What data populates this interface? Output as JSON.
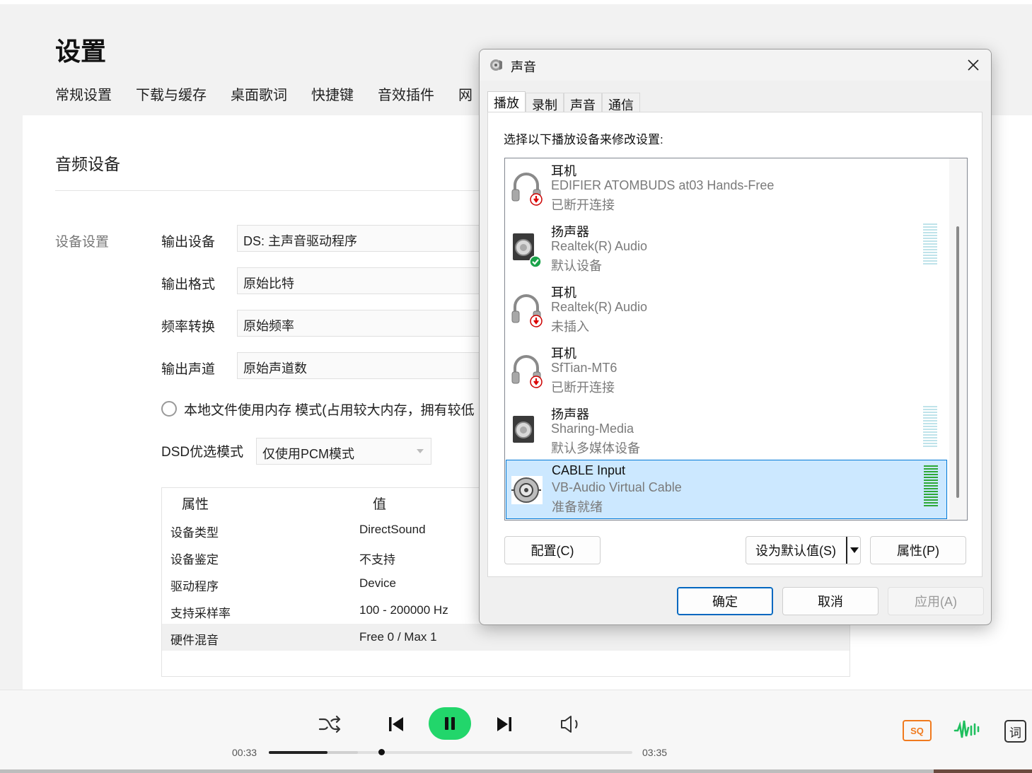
{
  "app": {
    "title": "设置",
    "tabs": [
      "常规设置",
      "下载与缓存",
      "桌面歌词",
      "快捷键",
      "音效插件",
      "网"
    ],
    "section_title": "音频设备",
    "group_label": "设备设置",
    "rows": [
      {
        "label": "输出设备",
        "value": "DS: 主声音驱动程序"
      },
      {
        "label": "输出格式",
        "value": "原始比特"
      },
      {
        "label": "频率转换",
        "value": "原始频率"
      },
      {
        "label": "输出声道",
        "value": "原始声道数"
      }
    ],
    "memory_mode_text": "本地文件使用内存 模式(占用较大内存，拥有较低",
    "dsd_label": "DSD优选模式",
    "dsd_value": "仅使用PCM模式",
    "props": {
      "col_key": "属性",
      "col_value": "值",
      "rows": [
        {
          "k": "设备类型",
          "v": "DirectSound"
        },
        {
          "k": "设备鉴定",
          "v": "不支持"
        },
        {
          "k": "驱动程序",
          "v": "Device"
        },
        {
          "k": "支持采样率",
          "v": "100 - 200000 Hz"
        },
        {
          "k": "硬件混音",
          "v": "Free 0 / Max 1"
        }
      ]
    }
  },
  "player": {
    "current_time": "00:33",
    "total_time": "03:35",
    "quality_badge": "SQ",
    "lyric_label": "词",
    "accent": "#22d66b"
  },
  "dialog": {
    "title": "声音",
    "tabs": [
      "播放",
      "录制",
      "声音",
      "通信"
    ],
    "instruction": "选择以下播放设备来修改设置:",
    "devices": [
      {
        "name": "耳机",
        "detail": "EDIFIER ATOMBUDS at03 Hands-Free",
        "status": "已断开连接",
        "icon": "headphones-icon",
        "badge": "disconnected"
      },
      {
        "name": "扬声器",
        "detail": "Realtek(R) Audio",
        "status": "默认设备",
        "icon": "speaker-icon",
        "badge": "default"
      },
      {
        "name": "耳机",
        "detail": "Realtek(R) Audio",
        "status": "未插入",
        "icon": "headphones-icon",
        "badge": "disconnected"
      },
      {
        "name": "耳机",
        "detail": "SfTian-MT6",
        "status": "已断开连接",
        "icon": "headphones-icon",
        "badge": "disconnected"
      },
      {
        "name": "扬声器",
        "detail": "Sharing-Media",
        "status": "默认多媒体设备",
        "icon": "speaker-icon",
        "badge": "none"
      },
      {
        "name": "CABLE Input",
        "detail": "VB-Audio Virtual Cable",
        "status": "准备就绪",
        "icon": "cable-icon",
        "badge": "none"
      }
    ],
    "buttons": {
      "configure": "配置(C)",
      "set_default": "设为默认值(S)",
      "properties": "属性(P)",
      "ok": "确定",
      "cancel": "取消",
      "apply": "应用(A)"
    }
  }
}
